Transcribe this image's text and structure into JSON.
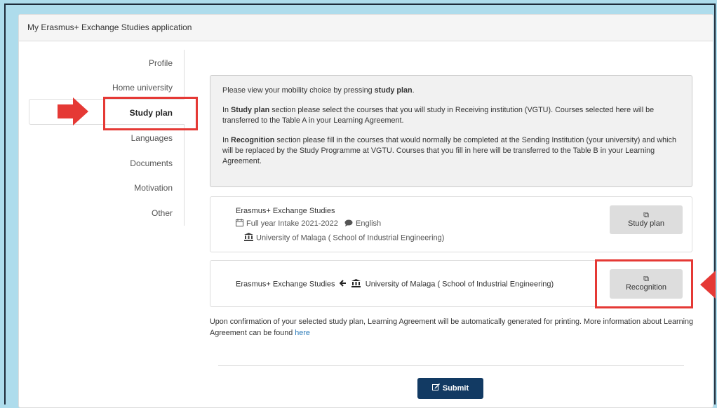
{
  "panel": {
    "title": "My Erasmus+ Exchange Studies application"
  },
  "nav": {
    "items": [
      {
        "label": "Profile"
      },
      {
        "label": "Home university"
      },
      {
        "label": "Study plan"
      },
      {
        "label": "Languages"
      },
      {
        "label": "Documents"
      },
      {
        "label": "Motivation"
      },
      {
        "label": "Other"
      }
    ],
    "active": "Study plan"
  },
  "info": {
    "p1_prefix": "Please view your mobility choice by pressing ",
    "p1_bold": "study plan",
    "p1_suffix": ".",
    "p2_prefix": "In ",
    "p2_bold": "Study plan",
    "p2_suffix": " section please select the courses that you will study in Receiving institution (VGTU). Courses selected here will be transferred to the Table A in your Learning Agreement.",
    "p3_prefix": "In ",
    "p3_bold": "Recognition",
    "p3_suffix": " section please fill in the courses that would normally be completed at the Sending Institution (your university) and which will be replaced by the Study Programme at VGTU. Courses that you fill in here will be transferred to the Table B in your Learning Agreement."
  },
  "study_card": {
    "title": "Erasmus+ Exchange Studies",
    "intake": "Full year Intake 2021-2022",
    "language": "English",
    "university": "University of Malaga ( School of Industrial Engineering)",
    "button_label": "Study plan"
  },
  "recognition_card": {
    "program": "Erasmus+ Exchange Studies",
    "university": "University of Malaga ( School of Industrial Engineering)",
    "button_label": "Recognition"
  },
  "footer": {
    "text": "Upon confirmation of your selected study plan, Learning Agreement will be automatically generated for printing. More information about Learning Agreement can be found ",
    "link": "here"
  },
  "submit": {
    "label": "Submit"
  },
  "colors": {
    "accent_red": "#e53935",
    "submit_bg": "#123a63",
    "link": "#2a7ab8",
    "background": "#aedcec"
  },
  "icons": {
    "calendar": "calendar-icon",
    "comment": "comment-icon",
    "institution": "institution-icon",
    "arrow_left": "arrow-left-icon",
    "cubes": "cubes-icon",
    "edit": "edit-icon"
  }
}
